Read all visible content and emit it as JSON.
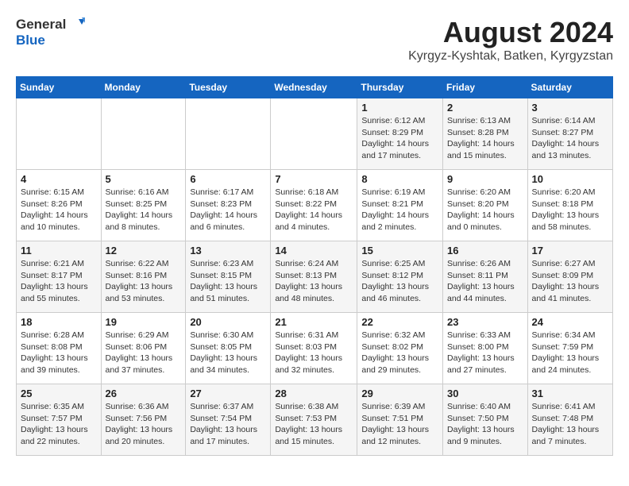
{
  "header": {
    "logo_line1": "General",
    "logo_line2": "Blue",
    "month_year": "August 2024",
    "location": "Kyrgyz-Kyshtak, Batken, Kyrgyzstan"
  },
  "weekdays": [
    "Sunday",
    "Monday",
    "Tuesday",
    "Wednesday",
    "Thursday",
    "Friday",
    "Saturday"
  ],
  "weeks": [
    [
      {
        "day": "",
        "info": ""
      },
      {
        "day": "",
        "info": ""
      },
      {
        "day": "",
        "info": ""
      },
      {
        "day": "",
        "info": ""
      },
      {
        "day": "1",
        "info": "Sunrise: 6:12 AM\nSunset: 8:29 PM\nDaylight: 14 hours\nand 17 minutes."
      },
      {
        "day": "2",
        "info": "Sunrise: 6:13 AM\nSunset: 8:28 PM\nDaylight: 14 hours\nand 15 minutes."
      },
      {
        "day": "3",
        "info": "Sunrise: 6:14 AM\nSunset: 8:27 PM\nDaylight: 14 hours\nand 13 minutes."
      }
    ],
    [
      {
        "day": "4",
        "info": "Sunrise: 6:15 AM\nSunset: 8:26 PM\nDaylight: 14 hours\nand 10 minutes."
      },
      {
        "day": "5",
        "info": "Sunrise: 6:16 AM\nSunset: 8:25 PM\nDaylight: 14 hours\nand 8 minutes."
      },
      {
        "day": "6",
        "info": "Sunrise: 6:17 AM\nSunset: 8:23 PM\nDaylight: 14 hours\nand 6 minutes."
      },
      {
        "day": "7",
        "info": "Sunrise: 6:18 AM\nSunset: 8:22 PM\nDaylight: 14 hours\nand 4 minutes."
      },
      {
        "day": "8",
        "info": "Sunrise: 6:19 AM\nSunset: 8:21 PM\nDaylight: 14 hours\nand 2 minutes."
      },
      {
        "day": "9",
        "info": "Sunrise: 6:20 AM\nSunset: 8:20 PM\nDaylight: 14 hours\nand 0 minutes."
      },
      {
        "day": "10",
        "info": "Sunrise: 6:20 AM\nSunset: 8:18 PM\nDaylight: 13 hours\nand 58 minutes."
      }
    ],
    [
      {
        "day": "11",
        "info": "Sunrise: 6:21 AM\nSunset: 8:17 PM\nDaylight: 13 hours\nand 55 minutes."
      },
      {
        "day": "12",
        "info": "Sunrise: 6:22 AM\nSunset: 8:16 PM\nDaylight: 13 hours\nand 53 minutes."
      },
      {
        "day": "13",
        "info": "Sunrise: 6:23 AM\nSunset: 8:15 PM\nDaylight: 13 hours\nand 51 minutes."
      },
      {
        "day": "14",
        "info": "Sunrise: 6:24 AM\nSunset: 8:13 PM\nDaylight: 13 hours\nand 48 minutes."
      },
      {
        "day": "15",
        "info": "Sunrise: 6:25 AM\nSunset: 8:12 PM\nDaylight: 13 hours\nand 46 minutes."
      },
      {
        "day": "16",
        "info": "Sunrise: 6:26 AM\nSunset: 8:11 PM\nDaylight: 13 hours\nand 44 minutes."
      },
      {
        "day": "17",
        "info": "Sunrise: 6:27 AM\nSunset: 8:09 PM\nDaylight: 13 hours\nand 41 minutes."
      }
    ],
    [
      {
        "day": "18",
        "info": "Sunrise: 6:28 AM\nSunset: 8:08 PM\nDaylight: 13 hours\nand 39 minutes."
      },
      {
        "day": "19",
        "info": "Sunrise: 6:29 AM\nSunset: 8:06 PM\nDaylight: 13 hours\nand 37 minutes."
      },
      {
        "day": "20",
        "info": "Sunrise: 6:30 AM\nSunset: 8:05 PM\nDaylight: 13 hours\nand 34 minutes."
      },
      {
        "day": "21",
        "info": "Sunrise: 6:31 AM\nSunset: 8:03 PM\nDaylight: 13 hours\nand 32 minutes."
      },
      {
        "day": "22",
        "info": "Sunrise: 6:32 AM\nSunset: 8:02 PM\nDaylight: 13 hours\nand 29 minutes."
      },
      {
        "day": "23",
        "info": "Sunrise: 6:33 AM\nSunset: 8:00 PM\nDaylight: 13 hours\nand 27 minutes."
      },
      {
        "day": "24",
        "info": "Sunrise: 6:34 AM\nSunset: 7:59 PM\nDaylight: 13 hours\nand 24 minutes."
      }
    ],
    [
      {
        "day": "25",
        "info": "Sunrise: 6:35 AM\nSunset: 7:57 PM\nDaylight: 13 hours\nand 22 minutes."
      },
      {
        "day": "26",
        "info": "Sunrise: 6:36 AM\nSunset: 7:56 PM\nDaylight: 13 hours\nand 20 minutes."
      },
      {
        "day": "27",
        "info": "Sunrise: 6:37 AM\nSunset: 7:54 PM\nDaylight: 13 hours\nand 17 minutes."
      },
      {
        "day": "28",
        "info": "Sunrise: 6:38 AM\nSunset: 7:53 PM\nDaylight: 13 hours\nand 15 minutes."
      },
      {
        "day": "29",
        "info": "Sunrise: 6:39 AM\nSunset: 7:51 PM\nDaylight: 13 hours\nand 12 minutes."
      },
      {
        "day": "30",
        "info": "Sunrise: 6:40 AM\nSunset: 7:50 PM\nDaylight: 13 hours\nand 9 minutes."
      },
      {
        "day": "31",
        "info": "Sunrise: 6:41 AM\nSunset: 7:48 PM\nDaylight: 13 hours\nand 7 minutes."
      }
    ]
  ]
}
